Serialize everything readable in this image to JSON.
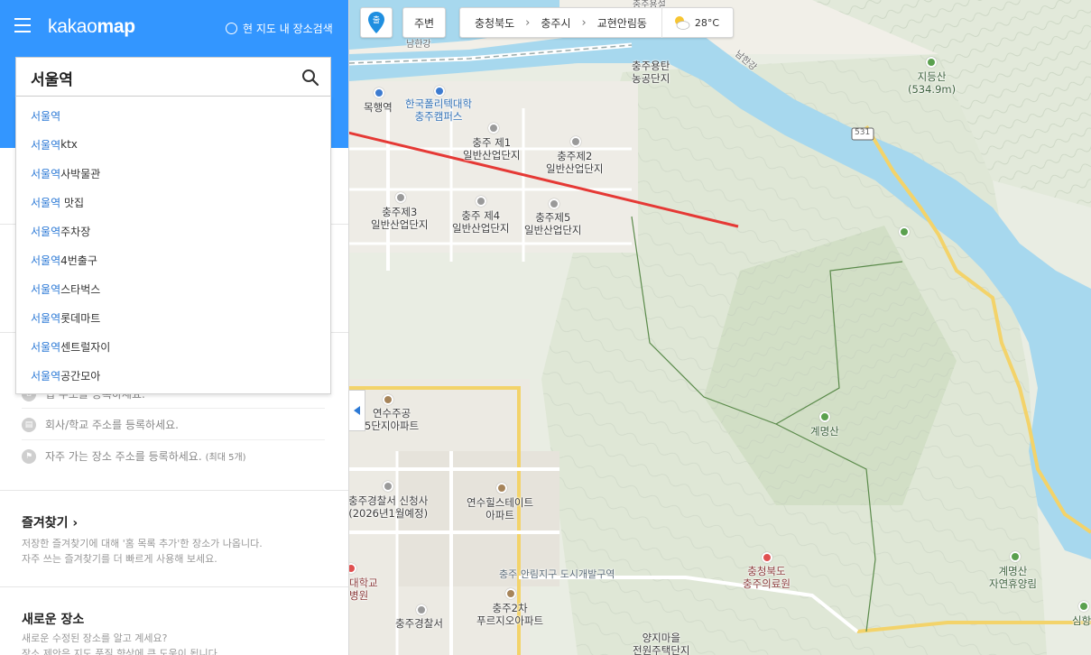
{
  "app": {
    "logo_light": "kakao",
    "logo_bold": "map",
    "map_search_toggle": "현 지도 내 장소검색"
  },
  "search": {
    "value": "서울역",
    "suggestions": [
      {
        "hl": "서울역",
        "rest": ""
      },
      {
        "hl": "서울역",
        "rest": "ktx"
      },
      {
        "hl": "서울역",
        "rest": "사박물관"
      },
      {
        "hl": "서울역",
        "rest": " 맛집"
      },
      {
        "hl": "서울역",
        "rest": "주차장"
      },
      {
        "hl": "서울역",
        "rest": "4번출구"
      },
      {
        "hl": "서울역",
        "rest": "스타벅스"
      },
      {
        "hl": "서울역",
        "rest": "롯데마트"
      },
      {
        "hl": "서울역",
        "rest": "센트럴자이"
      },
      {
        "hl": "서울역",
        "rest": "공간모아"
      }
    ]
  },
  "sidebar": {
    "home_text": "집 주소를 등록하세요.",
    "work_text": "회사/학교 주소를 등록하세요.",
    "freq_text": "자주 가는 장소 주소를 등록하세요.",
    "freq_note": "(최대 5개)",
    "favorites_title": "즐겨찾기 ›",
    "favorites_desc_1": "저장한 즐겨찾기에 대해 '홈 목록 추가'한 장소가 나옵니다.",
    "favorites_desc_2": "자주 쓰는 즐겨찾기를 더 빠르게 사용해 보세요.",
    "new_places_title": "새로운 장소",
    "new_places_desc_1": "새로운 수정된 장소를 알고 계세요?",
    "new_places_desc_2": "장소 제안은 지도 품질 향상에 큰 도움이 됩니다."
  },
  "map_controls": {
    "roadview_label": "출",
    "nearby_label": "주변",
    "breadcrumbs": [
      "충청북도",
      "충주시",
      "교현안림동"
    ],
    "temperature": "28°C"
  },
  "map_labels": {
    "river_south": "남한강",
    "river_north": "남한강",
    "top_cut": "충주용설",
    "yongtan": "충주용탄\n농공단지",
    "mokhaeng": "목행역",
    "polytech": "한국폴리텍대학\n충주캠퍼스",
    "ind1": "충주 제1\n일반산업단지",
    "ind2": "충주제2\n일반산업단지",
    "ind3": "충주제3\n일반산업단지",
    "ind4": "충주 제4\n일반산업단지",
    "ind5": "충주제5\n일반산업단지",
    "jidungsan": "지등산\n(534.9m)",
    "route": "531",
    "gyemyeongsan": "계명산",
    "yeonsu_apt": "연수주공\n5단지아파트",
    "police_new": "충주경찰서 신청사\n(2026년1월예정)",
    "yeonsu_hills": "연수힐스테이트\n아파트",
    "anlim_district": "충주 안림지구 도시개발구역",
    "hospital_left": "대학교\n병원",
    "medical_center": "충청북도\n충주의료원",
    "forest": "계명산\n자연휴양림",
    "sim": "심항",
    "purgio": "충주2차\n푸르지오아파트",
    "police": "충주경찰서",
    "yangji": "양지마을\n전원주택단지"
  },
  "colors": {
    "header_blue": "#3396ff",
    "highlight_blue": "#2d7ad6",
    "river": "#a7d8ee",
    "arrow": "#e53935"
  }
}
